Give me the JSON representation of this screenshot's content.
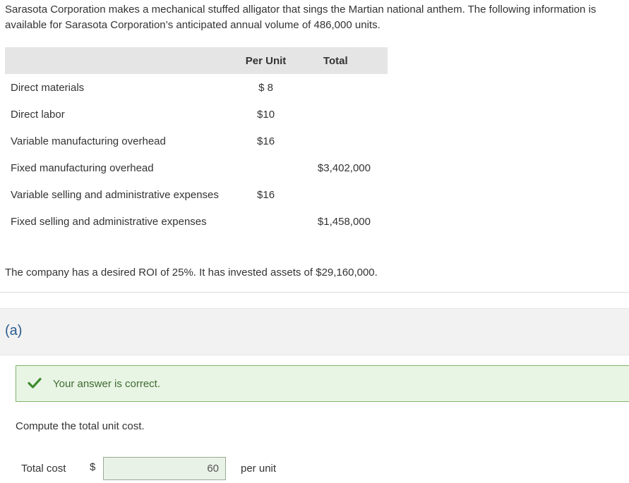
{
  "intro_text": "Sarasota Corporation makes a mechanical stuffed alligator that sings the Martian national anthem. The following information is available for Sarasota Corporation’s anticipated annual volume of 486,000 units.",
  "table": {
    "headers": {
      "label": "",
      "per_unit": "Per Unit",
      "total": "Total"
    },
    "rows": [
      {
        "label": "Direct materials",
        "per_unit": "$ 8",
        "total": ""
      },
      {
        "label": "Direct labor",
        "per_unit": "$10",
        "total": ""
      },
      {
        "label": "Variable manufacturing overhead",
        "per_unit": "$16",
        "total": ""
      },
      {
        "label": "Fixed manufacturing overhead",
        "per_unit": "",
        "total": "$3,402,000"
      },
      {
        "label": "Variable selling and administrative expenses",
        "per_unit": "$16",
        "total": ""
      },
      {
        "label": "Fixed selling and administrative expenses",
        "per_unit": "",
        "total": "$1,458,000"
      }
    ]
  },
  "roi_text": "The company has a desired ROI of 25%. It has invested assets of $29,160,000.",
  "part": {
    "label": "(a)",
    "status_text": "Your answer is correct.",
    "status_color": "#3d6b32",
    "check_icon": "check-icon",
    "question": "Compute the total unit cost.",
    "answer": {
      "label": "Total cost",
      "currency": "$",
      "value": "60",
      "unit": "per unit"
    }
  }
}
